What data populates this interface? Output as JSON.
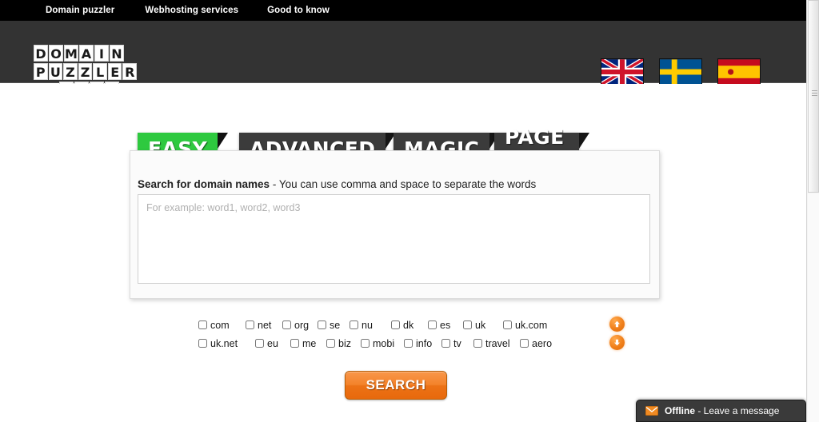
{
  "topnav": {
    "items": [
      {
        "label": "Domain puzzler"
      },
      {
        "label": "Webhosting services"
      },
      {
        "label": "Good to know"
      }
    ]
  },
  "header": {
    "logo": {
      "line1": "DOMAIN",
      "line2": "PUZZLER",
      "line3": ".COM",
      "alt": "Domain Puzzler .com"
    },
    "flags": [
      {
        "name": "flag-uk",
        "label": "United Kingdom"
      },
      {
        "name": "flag-sweden",
        "label": "Sweden"
      },
      {
        "name": "flag-spain",
        "label": "Spain"
      }
    ]
  },
  "tabs": [
    {
      "label": "EASY",
      "active": true
    },
    {
      "label": "ADVANCED",
      "active": false
    },
    {
      "label": "MAGIC",
      "active": false
    },
    {
      "label": "PAGE RANK",
      "active": false
    }
  ],
  "panel": {
    "label_bold": "Search for domain names",
    "label_rest": " - You can use comma and space to separate the words",
    "search_value": "",
    "search_placeholder": "For example: word1, word2, word3"
  },
  "tlds": {
    "row1": [
      {
        "label": "com",
        "checked": false
      },
      {
        "label": "net",
        "checked": false
      },
      {
        "label": "org",
        "checked": false
      },
      {
        "label": "se",
        "checked": false
      },
      {
        "label": "nu",
        "checked": false
      },
      {
        "label": "dk",
        "checked": false
      },
      {
        "label": "es",
        "checked": false
      },
      {
        "label": "uk",
        "checked": false
      },
      {
        "label": "uk.com",
        "checked": false
      }
    ],
    "row2": [
      {
        "label": "uk.net",
        "checked": false
      },
      {
        "label": "eu",
        "checked": false
      },
      {
        "label": "me",
        "checked": false
      },
      {
        "label": "biz",
        "checked": false
      },
      {
        "label": "mobi",
        "checked": false
      },
      {
        "label": "info",
        "checked": false
      },
      {
        "label": "tv",
        "checked": false
      },
      {
        "label": "travel",
        "checked": false
      },
      {
        "label": "aero",
        "checked": false
      }
    ]
  },
  "arrows": {
    "up": "scroll-up-arrow",
    "down": "scroll-down-arrow"
  },
  "search_button": {
    "label": "SEARCH"
  },
  "chat": {
    "status_bold": "Offline",
    "status_rest": " - Leave a message"
  },
  "colors": {
    "accent_green": "#2ec93f",
    "accent_orange": "#ee7a15",
    "header_dark": "#333333",
    "tab_dark": "#3b3b3b",
    "topnav_black": "#000000"
  }
}
